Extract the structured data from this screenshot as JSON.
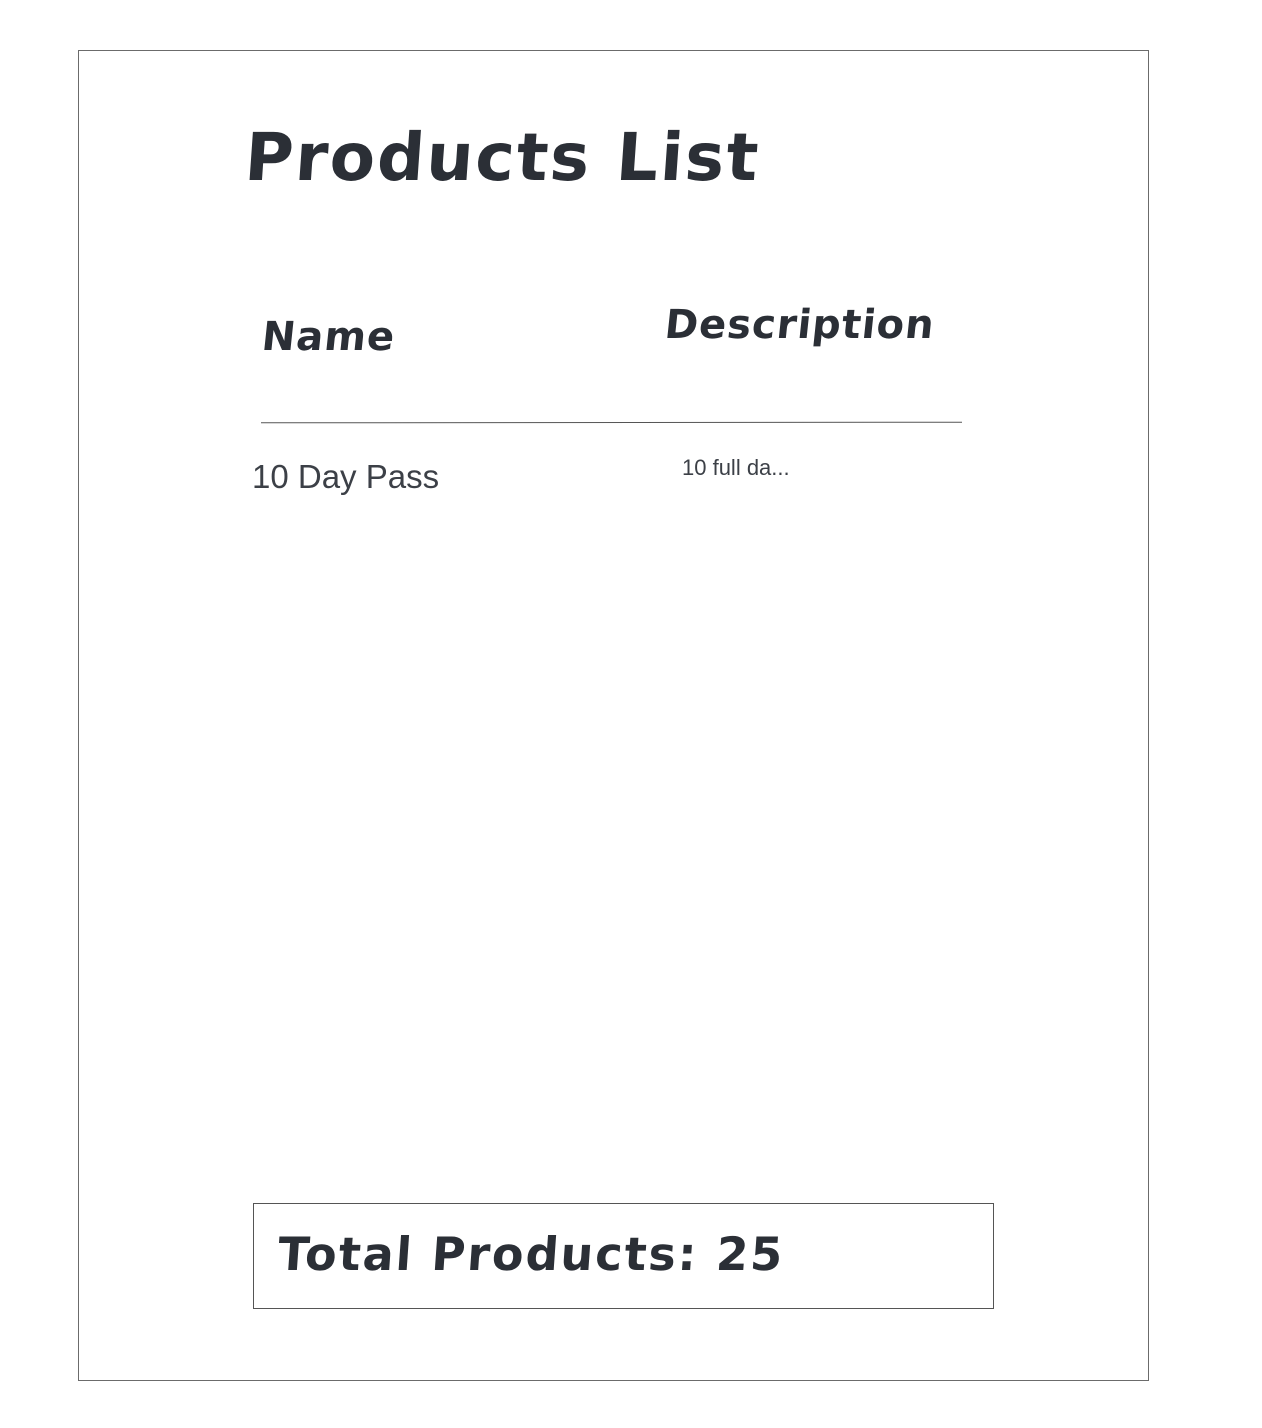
{
  "page": {
    "title": "Products List"
  },
  "table": {
    "columns": [
      "Name",
      "Description"
    ],
    "rows": [
      {
        "name": "10 Day Pass",
        "description": "10 full da..."
      }
    ]
  },
  "footer": {
    "total_label": "Total Products: 25"
  }
}
